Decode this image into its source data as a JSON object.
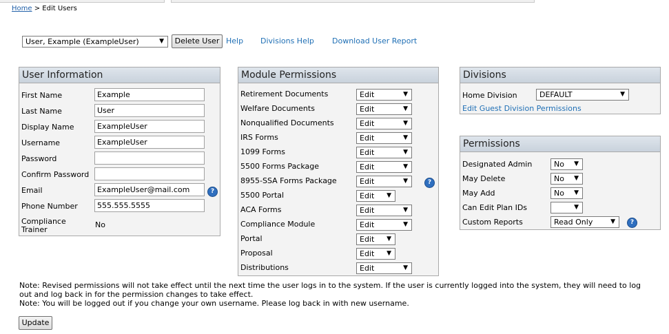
{
  "breadcrumb": {
    "home": "Home",
    "separator": " > ",
    "current": "Edit Users"
  },
  "toolbar": {
    "user_select": "User, Example (ExampleUser)",
    "delete_button": "Delete User",
    "help_link": "Help",
    "divisions_help_link": "Divisions Help",
    "download_link": "Download User Report"
  },
  "user_info": {
    "title": "User Information",
    "fields": [
      {
        "label": "First Name",
        "value": "Example"
      },
      {
        "label": "Last Name",
        "value": "User"
      },
      {
        "label": "Display Name",
        "value": "ExampleUser"
      },
      {
        "label": "Username",
        "value": "ExampleUser"
      },
      {
        "label": "Password",
        "value": ""
      },
      {
        "label": "Confirm Password",
        "value": ""
      },
      {
        "label": "Email",
        "value": "ExampleUser@mail.com"
      },
      {
        "label": "Phone Number",
        "value": "555.555.5555"
      }
    ],
    "compliance_label_1": "Compliance",
    "compliance_label_2": "Trainer",
    "compliance_value": "No"
  },
  "modules": {
    "title": "Module Permissions",
    "items": [
      {
        "label": "Retirement Documents",
        "value": "Edit"
      },
      {
        "label": "Welfare Documents",
        "value": "Edit"
      },
      {
        "label": "Nonqualified Documents",
        "value": "Edit"
      },
      {
        "label": "IRS Forms",
        "value": "Edit"
      },
      {
        "label": "1099 Forms",
        "value": "Edit"
      },
      {
        "label": "5500 Forms Package",
        "value": "Edit"
      },
      {
        "label": "8955-SSA Forms Package",
        "value": "Edit"
      },
      {
        "label": "5500 Portal",
        "value": "Edit"
      },
      {
        "label": "ACA Forms",
        "value": "Edit"
      },
      {
        "label": "Compliance Module",
        "value": "Edit"
      },
      {
        "label": "Portal",
        "value": "Edit"
      },
      {
        "label": "Proposal",
        "value": "Edit"
      },
      {
        "label": "Distributions",
        "value": "Edit"
      }
    ]
  },
  "divisions": {
    "title": "Divisions",
    "home_label": "Home Division",
    "home_value": "DEFAULT",
    "guest_link": "Edit Guest Division Permissions"
  },
  "permissions": {
    "title": "Permissions",
    "items": [
      {
        "label": "Designated Admin",
        "value": "No"
      },
      {
        "label": "May Delete",
        "value": "No"
      },
      {
        "label": "May Add",
        "value": "No"
      },
      {
        "label": "Can Edit Plan IDs",
        "value": ""
      },
      {
        "label": "Custom Reports",
        "value": "Read Only"
      }
    ]
  },
  "notes": {
    "line1": "Note: Revised permissions will not take effect until the next time the user logs in to the system. If the user is currently logged into the system, they will need to log",
    "line2": "out and log back in for the permission changes to take effect.",
    "line3": "Note: You will be logged out if you change your own username. Please log back in with new username."
  },
  "update_button": "Update",
  "help_glyph": "?",
  "arrow_glyph": "▼"
}
